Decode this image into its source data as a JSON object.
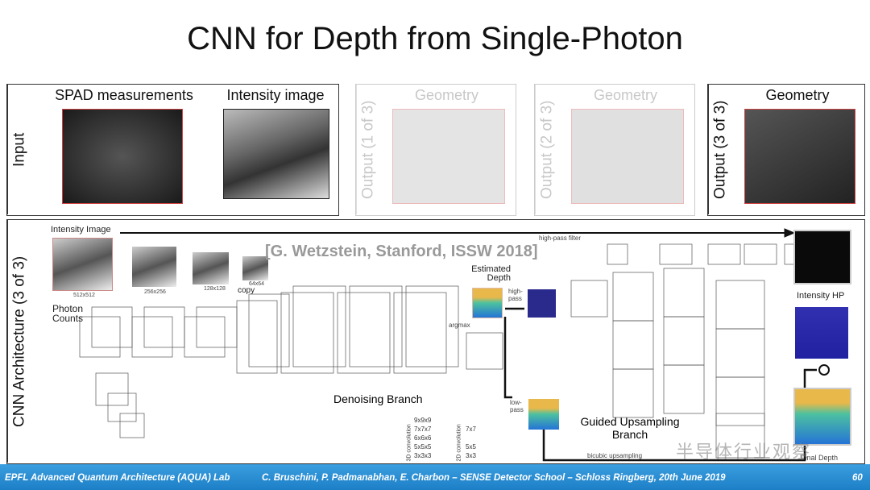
{
  "title": "CNN for Depth from Single-Photon",
  "top_row": {
    "input_label": "Input",
    "spad_caption": "SPAD measurements",
    "intensity_caption": "Intensity image",
    "outputs": [
      {
        "label": "Output (1 of 3)",
        "caption": "Geometry"
      },
      {
        "label": "Output (2 of 3)",
        "caption": "Geometry"
      },
      {
        "label": "Output (3 of 3)",
        "caption": "Geometry"
      }
    ]
  },
  "architecture": {
    "side_label": "CNN Architecture (3 of 3)",
    "citation": "[G. Wetzstein, Stanford, ISSW 2018]",
    "intensity_image": "Intensity Image",
    "photon_counts": "Photon Counts",
    "copy": "copy",
    "high_pass_filter": "high-pass filter",
    "estimated_depth": "Estimated Depth",
    "argmax": "argmax",
    "high_pass": "high-pass",
    "low_pass": "low-pass",
    "intensity_hp": "Intensity HP",
    "denoising_branch": "Denoising Branch",
    "guided_upsampling": "Guided Upsampling Branch",
    "bicubic_upsampling": "bicubic upsampling",
    "final_depth": "Final Depth",
    "legend": {
      "conv3d_title": "3D convolution",
      "conv3d": [
        "9x9x9",
        "7x7x7",
        "6x6x6",
        "5x5x5",
        "3x3x3"
      ],
      "conv2d_title": "2D convolution",
      "conv2d": [
        "7x7",
        "5x5",
        "3x3"
      ]
    },
    "dims": [
      "512x512",
      "256x256",
      "128x128",
      "64x64"
    ],
    "watermark": "半导体行业观察"
  },
  "footer": {
    "lab": "EPFL Advanced Quantum Architecture (AQUA) Lab",
    "credits": "C. Bruschini, P. Padmanabhan, E. Charbon – SENSE Detector School – Schloss Ringberg, 20th June 2019",
    "page": "60"
  },
  "colors": {
    "footer": "#1d7fc6",
    "frame": "#333333",
    "cube_edge": "#cc4444"
  }
}
